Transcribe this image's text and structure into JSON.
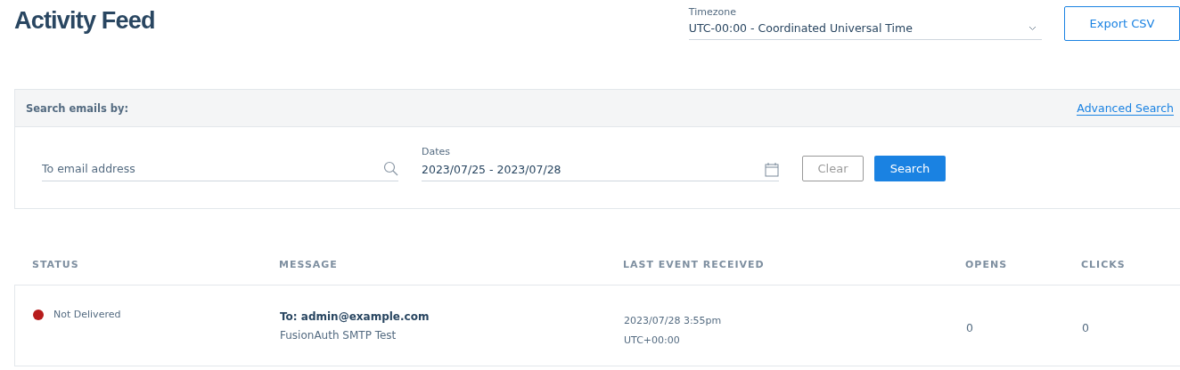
{
  "page": {
    "title": "Activity Feed"
  },
  "timezone": {
    "label": "Timezone",
    "value": "UTC-00:00 - Coordinated Universal Time"
  },
  "export_button": "Export CSV",
  "search_panel": {
    "heading": "Search emails by:",
    "advanced_link": "Advanced Search",
    "email_field": {
      "placeholder": "To email address"
    },
    "dates_field": {
      "label": "Dates",
      "value": "2023/07/25 - 2023/07/28"
    },
    "clear_button": {
      "label": "Clear",
      "disabled": true
    },
    "search_button": "Search"
  },
  "table": {
    "columns": [
      "STATUS",
      "MESSAGE",
      "LAST EVENT RECEIVED",
      "OPENS",
      "CLICKS"
    ],
    "rows": [
      {
        "status": "Not Delivered",
        "color": "#b71c1c",
        "to": "To: admin@example.com",
        "subject": "FusionAuth SMTP Test",
        "date": "2023/07/28 3:55pm",
        "zone": "UTC+00:00",
        "opens": "0",
        "clicks": "0"
      }
    ]
  }
}
